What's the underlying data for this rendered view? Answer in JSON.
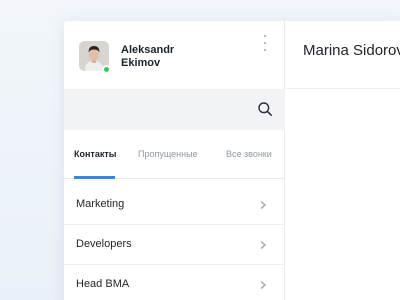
{
  "profile": {
    "name_line1": "Aleksandr",
    "name_line2": "Ekimov",
    "status": "online",
    "status_color": "#3bc659"
  },
  "search": {
    "icon": "search-icon"
  },
  "tabs": [
    {
      "label": "Контакты",
      "active": true
    },
    {
      "label": "Пропущенные",
      "active": false
    },
    {
      "label": "Все звонки",
      "active": false
    }
  ],
  "groups": [
    {
      "label": "Marketing"
    },
    {
      "label": "Developers"
    },
    {
      "label": "Head BMA"
    }
  ],
  "main": {
    "contact_name": "Marina Sidorova"
  },
  "colors": {
    "accent": "#3b86d6",
    "text": "#1c232c",
    "muted": "#8f98a3",
    "search_bg": "#f1f3f6"
  }
}
